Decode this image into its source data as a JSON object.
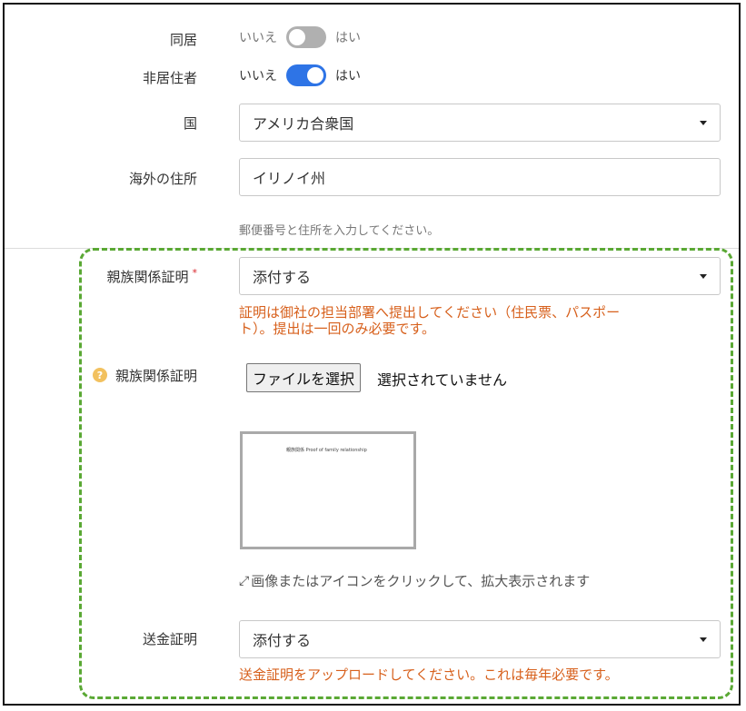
{
  "cohabitation": {
    "label": "同居",
    "no": "いいえ",
    "yes": "はい",
    "state": "off"
  },
  "non_resident": {
    "label": "非居住者",
    "no": "いいえ",
    "yes": "はい",
    "state": "on"
  },
  "country": {
    "label": "国",
    "value": "アメリカ合衆国"
  },
  "overseas_address": {
    "label": "海外の住所",
    "value": "イリノイ州",
    "hint": "郵便番号と住所を入力してください。"
  },
  "kinship_cert": {
    "label": "親族関係証明",
    "required_mark": "*",
    "value": "添付する",
    "warning_line1": "証明は御社の担当部署へ提出してください（住民票、パスポー",
    "warning_line2": "ト）。提出は一回のみ必要です。"
  },
  "kinship_file": {
    "label": "親族関係証明",
    "help_icon": "?",
    "button": "ファイルを選択",
    "status": "選択されていません",
    "thumbnail_text": "親族関係  Proof of family relationship",
    "expand_hint": "画像またはアイコンをクリックして、拡大表示されます"
  },
  "remittance_cert": {
    "label": "送金証明",
    "value": "添付する",
    "warning": "送金証明をアップロードしてください。これは毎年必要です。"
  },
  "colors": {
    "toggle_on": "#2e74e6",
    "warning": "#d7601c",
    "highlight": "#5aa834"
  }
}
